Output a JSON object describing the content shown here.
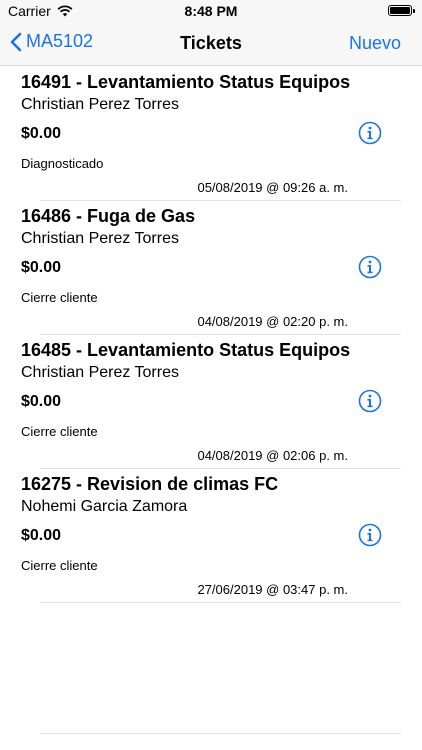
{
  "status_bar": {
    "carrier": "Carrier",
    "time": "8:48 PM"
  },
  "nav": {
    "back_label": "MA5102",
    "title": "Tickets",
    "new_label": "Nuevo"
  },
  "tickets": [
    {
      "title": "16491 - Levantamiento Status Equipos",
      "owner": "Christian Perez Torres",
      "amount": "$0.00",
      "status": "Diagnosticado",
      "date": "05/08/2019 @ 09:26 a. m."
    },
    {
      "title": "16486 - Fuga de Gas",
      "owner": "Christian Perez Torres",
      "amount": "$0.00",
      "status": "Cierre cliente",
      "date": "04/08/2019 @ 02:20 p. m."
    },
    {
      "title": "16485 - Levantamiento Status Equipos",
      "owner": "Christian Perez Torres",
      "amount": "$0.00",
      "status": "Cierre cliente",
      "date": "04/08/2019 @ 02:06 p. m."
    },
    {
      "title": "16275 - Revision de climas FC",
      "owner": "Nohemi Garcia Zamora",
      "amount": "$0.00",
      "status": "Cierre cliente",
      "date": "27/06/2019 @ 03:47 p. m."
    }
  ],
  "colors": {
    "accent": "#1a73e8",
    "divider": "#e3e3e3"
  },
  "icons": {
    "info": "info-circle-icon",
    "back": "chevron-left-icon"
  }
}
